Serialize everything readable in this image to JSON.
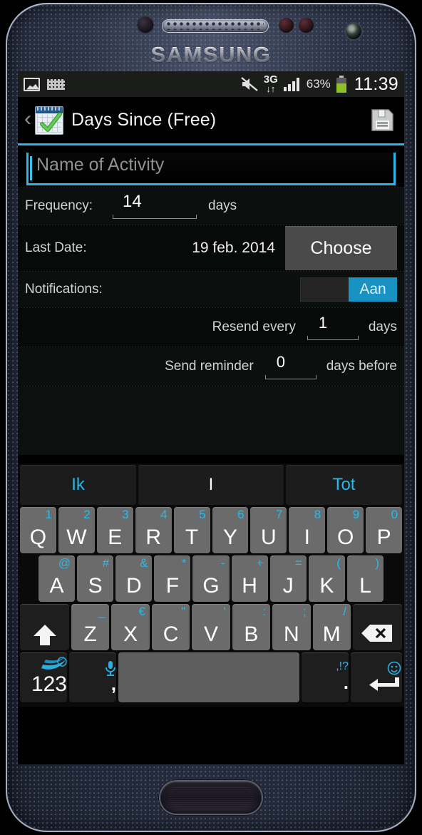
{
  "device": {
    "brand": "SAMSUNG"
  },
  "status_bar": {
    "icons_left": [
      "image-icon",
      "keyboard-icon"
    ],
    "mute_icon": "mute-icon",
    "network_type": "3G",
    "signal_icon": "signal-bars-icon",
    "battery_percent": "63%",
    "battery_icon": "battery-icon",
    "time": "11:39"
  },
  "action_bar": {
    "back_icon": "back-chevron-icon",
    "app_icon": "calendar-check-icon",
    "title": "Days Since (Free)",
    "save_icon": "save-floppy-icon"
  },
  "form": {
    "name_placeholder": "Name of Activity",
    "name_value": "",
    "frequency_label": "Frequency:",
    "frequency_value": "14",
    "frequency_unit": "days",
    "last_date_label": "Last Date:",
    "last_date_value": "19 feb. 2014",
    "choose_label": "Choose",
    "notifications_label": "Notifications:",
    "notifications_toggle": "Aan",
    "resend_label": "Resend every",
    "resend_value": "1",
    "resend_unit": "days",
    "reminder_label": "Send reminder",
    "reminder_value": "0",
    "reminder_unit": "days before"
  },
  "keyboard": {
    "suggestions": [
      {
        "text": "Ik",
        "current": false
      },
      {
        "text": "I",
        "current": true
      },
      {
        "text": "Tot",
        "current": false
      }
    ],
    "row1": [
      {
        "key": "Q",
        "alt": "1"
      },
      {
        "key": "W",
        "alt": "2"
      },
      {
        "key": "E",
        "alt": "3"
      },
      {
        "key": "R",
        "alt": "4"
      },
      {
        "key": "T",
        "alt": "5"
      },
      {
        "key": "Y",
        "alt": "6"
      },
      {
        "key": "U",
        "alt": "7"
      },
      {
        "key": "I",
        "alt": "8"
      },
      {
        "key": "O",
        "alt": "9"
      },
      {
        "key": "P",
        "alt": "0"
      }
    ],
    "row2": [
      {
        "key": "A",
        "alt": "@"
      },
      {
        "key": "S",
        "alt": "#"
      },
      {
        "key": "D",
        "alt": "&"
      },
      {
        "key": "F",
        "alt": "*"
      },
      {
        "key": "G",
        "alt": "-"
      },
      {
        "key": "H",
        "alt": "+"
      },
      {
        "key": "J",
        "alt": "="
      },
      {
        "key": "K",
        "alt": "("
      },
      {
        "key": "L",
        "alt": ")"
      }
    ],
    "row3": [
      {
        "key": "Z",
        "alt": "_"
      },
      {
        "key": "X",
        "alt": "€"
      },
      {
        "key": "C",
        "alt": "\""
      },
      {
        "key": "V",
        "alt": "'"
      },
      {
        "key": "B",
        "alt": ":"
      },
      {
        "key": "N",
        "alt": ";"
      },
      {
        "key": "M",
        "alt": "/"
      }
    ],
    "shift_icon": "shift-arrow-icon",
    "backspace_icon": "backspace-icon",
    "numeric_label": "123",
    "swiftkey_icon": "swiftkey-logo-icon",
    "mic_icon": "microphone-icon",
    "comma_label": ",",
    "space_label": "",
    "punct_alt": ",!?",
    "period_label": ".",
    "emoji_icon": "smiley-icon",
    "enter_icon": "enter-arrow-icon"
  },
  "colors": {
    "accent": "#29b6e8",
    "key_face": "#6b6b6b",
    "toggle_on": "#1792c2",
    "battery_green": "#8bc220"
  }
}
